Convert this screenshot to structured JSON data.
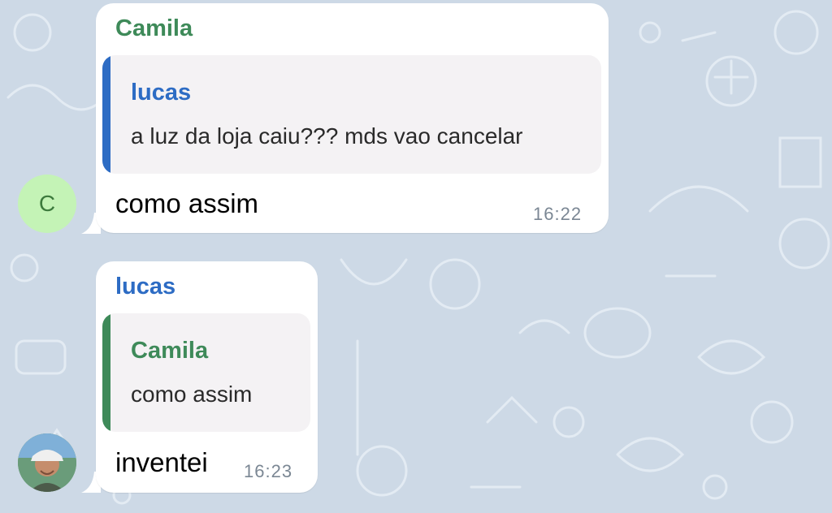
{
  "colors": {
    "background": "#cdd9e6",
    "camila_name": "#3e8a59",
    "lucas_name": "#2d6cc4",
    "bubble": "#ffffff",
    "reply_background": "#f4f2f4",
    "camila_avatar": "#c4f3b6"
  },
  "messages": [
    {
      "sender": "Camila",
      "avatar_initial": "C",
      "reply": {
        "name": "lucas",
        "text": "a luz da loja caiu??? mds vao cancelar"
      },
      "text": "como assim",
      "time": "16:22"
    },
    {
      "sender": "lucas",
      "avatar_icon": "user-photo",
      "reply": {
        "name": "Camila",
        "text": "como assim"
      },
      "text": "inventei",
      "time": "16:23"
    }
  ]
}
